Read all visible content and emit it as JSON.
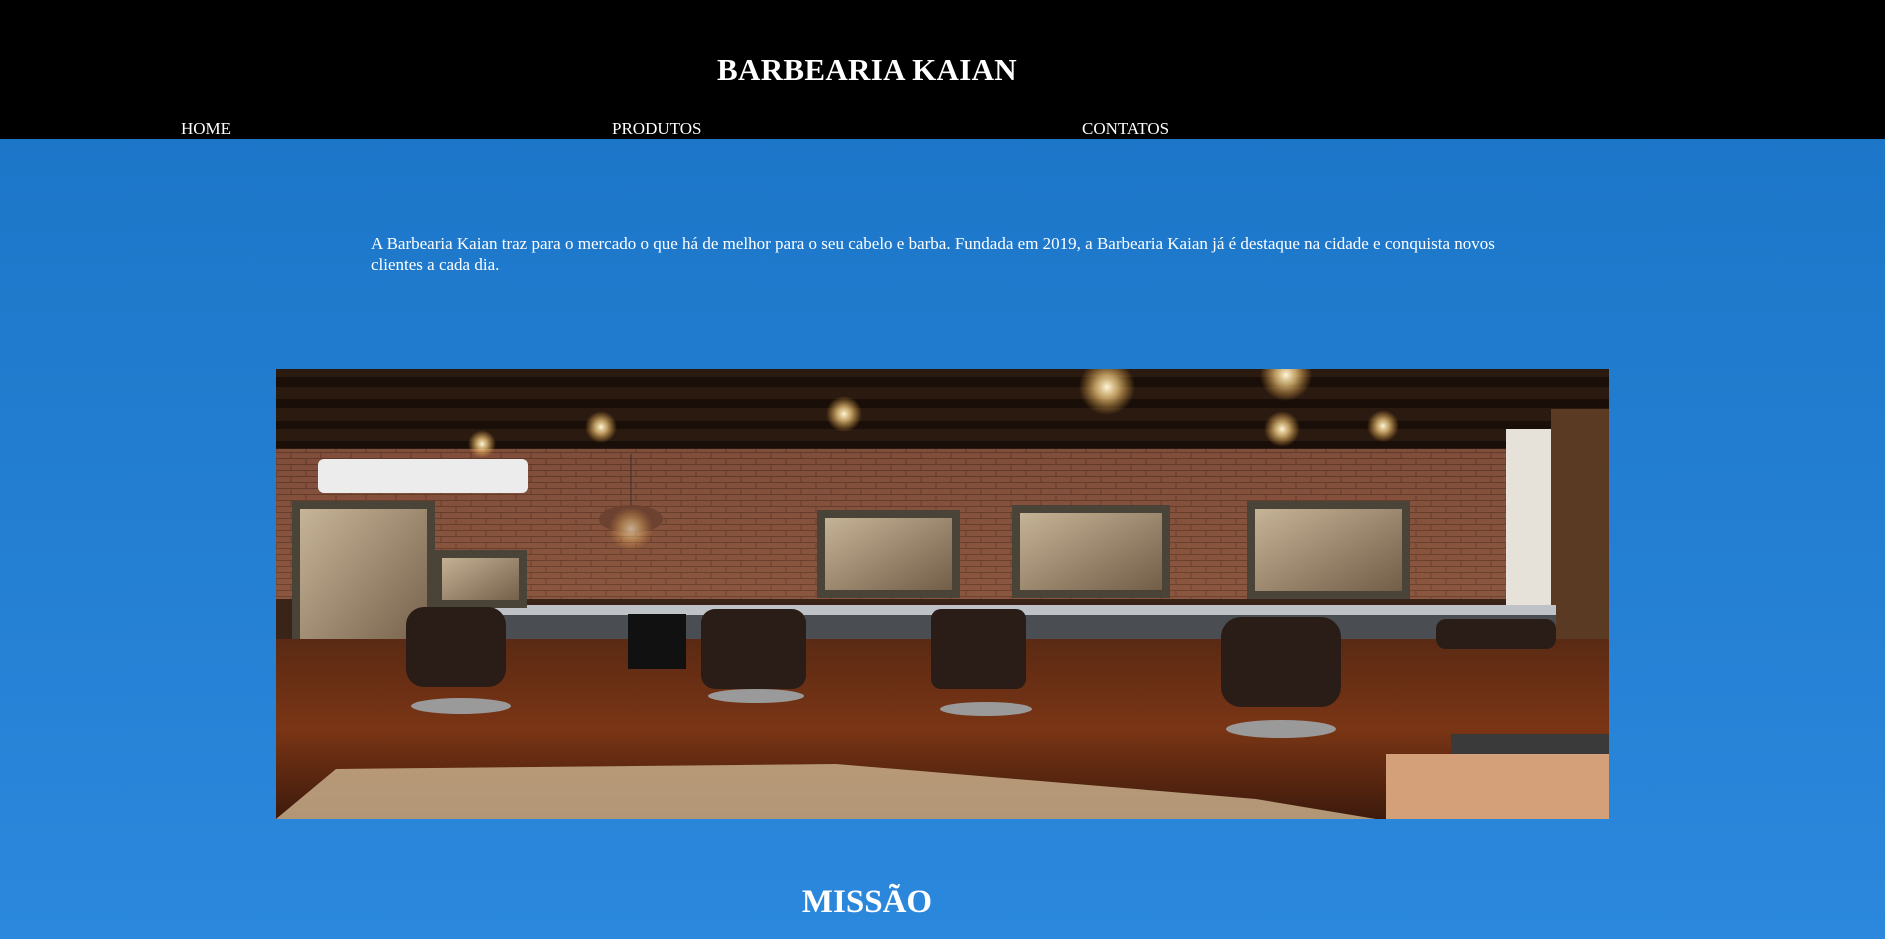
{
  "header": {
    "brand": "BARBEARIA KAIAN",
    "nav": [
      {
        "label": "HOME"
      },
      {
        "label": "PRODUTOS"
      },
      {
        "label": "CONTATOS"
      }
    ]
  },
  "main": {
    "intro": "A Barbearia Kaian traz para o mercado o que há de melhor para o seu cabelo e barba. Fundada em 2019, a Barbearia Kaian já é destaque na cidade e conquista novos clientes a cada dia.",
    "photo_alt": "Interior da barbearia",
    "section_heading": "MISSÃO"
  },
  "colors": {
    "header_bg": "#000000",
    "page_bg_top": "#1a73c5",
    "page_bg_bottom": "#2b88dc",
    "text": "#ffffff"
  }
}
